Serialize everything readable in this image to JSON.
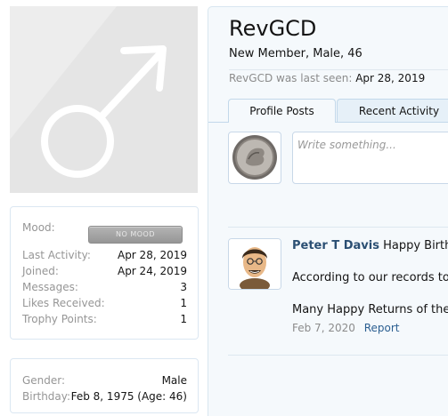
{
  "profile": {
    "username": "RevGCD",
    "subtitle": "New Member, Male, 46",
    "last_seen_label": "RevGCD was last seen:",
    "last_seen_value": "Apr 28, 2019"
  },
  "sidebar": {
    "mood_label": "Mood:",
    "mood_badge": "NO MOOD",
    "stats": [
      {
        "label": "Last Activity:",
        "value": "Apr 28, 2019"
      },
      {
        "label": "Joined:",
        "value": "Apr 24, 2019"
      },
      {
        "label": "Messages:",
        "value": "3"
      },
      {
        "label": "Likes Received:",
        "value": "1"
      },
      {
        "label": "Trophy Points:",
        "value": "1"
      }
    ],
    "info": [
      {
        "label": "Gender:",
        "value": "Male"
      },
      {
        "label": "Birthday:",
        "value": "Feb 8, 1975 (Age: 46)"
      }
    ]
  },
  "tabs": [
    {
      "label": "Profile Posts"
    },
    {
      "label": "Recent Activity"
    }
  ],
  "composer": {
    "placeholder": "Write something..."
  },
  "post": {
    "author": "Peter T Davis",
    "line1": " Happy Birthd",
    "line2": "According to our records to",
    "line3": "Many Happy Returns of the",
    "date": "Feb 7, 2020",
    "report": "Report"
  },
  "colors": {
    "link": "#2b4f73",
    "accent_border": "#c2d8ea",
    "background": "#f5f9fc"
  }
}
